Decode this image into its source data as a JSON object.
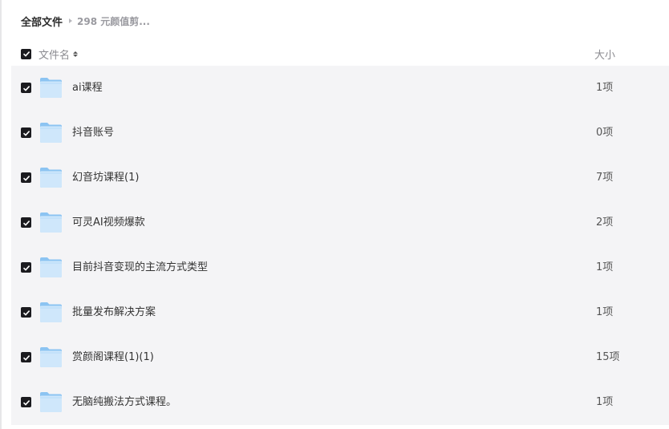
{
  "breadcrumb": {
    "root": "全部文件",
    "current": "298 元颜值剪..."
  },
  "header": {
    "name_label": "文件名",
    "size_label": "大小"
  },
  "colors": {
    "row_bg": "#f4f4f6",
    "checkbox": "#1b1b1f",
    "folder_light": "#cfe7fb",
    "folder_dark": "#8cc4f2"
  },
  "files": [
    {
      "name": "ai课程",
      "size": "1项",
      "icon": "folder-icon",
      "checked": true
    },
    {
      "name": "抖音账号",
      "size": "0项",
      "icon": "folder-icon",
      "checked": true
    },
    {
      "name": "幻音坊课程(1)",
      "size": "7项",
      "icon": "folder-icon",
      "checked": true
    },
    {
      "name": "可灵AI视频爆款",
      "size": "2项",
      "icon": "folder-icon",
      "checked": true
    },
    {
      "name": "目前抖音变现的主流方式类型",
      "size": "1项",
      "icon": "folder-icon",
      "checked": true
    },
    {
      "name": "批量发布解决方案",
      "size": "1项",
      "icon": "folder-icon",
      "checked": true
    },
    {
      "name": "赏颜阁课程(1)(1)",
      "size": "15项",
      "icon": "folder-icon",
      "checked": true
    },
    {
      "name": "无脑纯搬法方式课程。",
      "size": "1项",
      "icon": "folder-icon",
      "checked": true
    }
  ]
}
